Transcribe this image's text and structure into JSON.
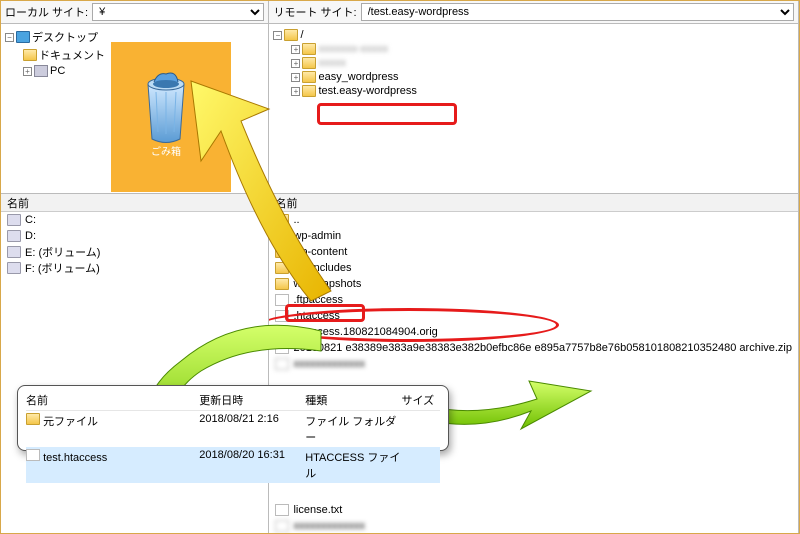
{
  "local": {
    "label": "ローカル サイト:",
    "path": "¥",
    "tree": {
      "root": "デスクトップ",
      "children": [
        "ドキュメント",
        "PC"
      ]
    },
    "trash_label": "ごみ箱",
    "list_header": "名前",
    "drives": [
      "C:",
      "D:",
      "E: (ボリューム)",
      "F: (ボリューム)"
    ]
  },
  "remote": {
    "label": "リモート サイト:",
    "path": "/test.easy-wordpress",
    "tree": {
      "root": "/",
      "children_blur": [
        "(hidden)",
        "(hidden)"
      ],
      "children": [
        "easy_wordpress",
        "test.easy-wordpress"
      ]
    },
    "list_header": "名前",
    "files": [
      {
        "name": "..",
        "icon": "folder"
      },
      {
        "name": "wp-admin",
        "icon": "folder"
      },
      {
        "name": "wp-content",
        "icon": "folder"
      },
      {
        "name": "wp-includes",
        "icon": "folder"
      },
      {
        "name": "wp-snapshots",
        "icon": "folder"
      },
      {
        "name": ".ftpaccess",
        "icon": "file"
      },
      {
        "name": ".htaccess",
        "icon": "file"
      },
      {
        "name": ".htaccess.180821084904.orig",
        "icon": "file"
      },
      {
        "name": "20180821 e38389e383a9e38383e382b0efbc86e e895a7757b8e76b058101808210352480 archive.zip",
        "icon": "file"
      }
    ],
    "files_bottom": [
      {
        "name": "license.txt",
        "icon": "file"
      }
    ]
  },
  "overlay": {
    "headers": {
      "name": "名前",
      "date": "更新日時",
      "type": "種類",
      "size": "サイズ"
    },
    "rows": [
      {
        "name": "元ファイル",
        "date": "2018/08/21 2:16",
        "type": "ファイル フォルダー",
        "size": ""
      },
      {
        "name": "test.htaccess",
        "date": "2018/08/20 16:31",
        "type": "HTACCESS ファイル",
        "size": ""
      }
    ]
  }
}
